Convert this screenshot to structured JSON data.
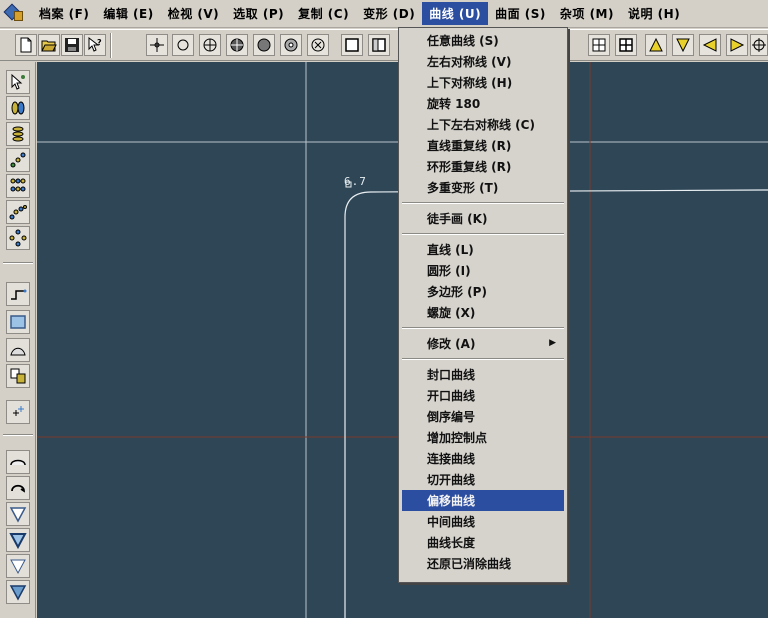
{
  "menubar": {
    "items": [
      {
        "label": "档案 (F)"
      },
      {
        "label": "编辑 (E)"
      },
      {
        "label": "检视 (V)"
      },
      {
        "label": "选取 (P)"
      },
      {
        "label": "复制 (C)"
      },
      {
        "label": "变形 (D)"
      },
      {
        "label": "曲线 (U)"
      },
      {
        "label": "曲面 (S)"
      },
      {
        "label": "杂项 (M)"
      },
      {
        "label": "说明 (H)"
      }
    ],
    "active_index": 6
  },
  "canvas": {
    "coord_label": "6.7"
  },
  "curve_menu": {
    "items": [
      {
        "label": "任意曲线 (S)",
        "type": "item"
      },
      {
        "label": "左右对称线 (V)",
        "type": "item"
      },
      {
        "label": "上下对称线 (H)",
        "type": "item"
      },
      {
        "label": "旋转 180",
        "type": "item"
      },
      {
        "label": "上下左右对称线 (C)",
        "type": "item"
      },
      {
        "label": "直线重复线 (R)",
        "type": "item"
      },
      {
        "label": "环形重复线 (R)",
        "type": "item"
      },
      {
        "label": "多重变形 (T)",
        "type": "item"
      },
      {
        "type": "separator"
      },
      {
        "label": "徒手画 (K)",
        "type": "item"
      },
      {
        "type": "separator"
      },
      {
        "label": "直线 (L)",
        "type": "item"
      },
      {
        "label": "圆形 (I)",
        "type": "item"
      },
      {
        "label": "多边形 (P)",
        "type": "item"
      },
      {
        "label": "螺旋 (X)",
        "type": "item"
      },
      {
        "type": "separator"
      },
      {
        "label": "修改 (A)",
        "type": "submenu"
      },
      {
        "type": "separator"
      },
      {
        "label": "封口曲线",
        "type": "item"
      },
      {
        "label": "开口曲线",
        "type": "item"
      },
      {
        "label": "倒序编号",
        "type": "item"
      },
      {
        "label": "增加控制点",
        "type": "item"
      },
      {
        "label": "连接曲线",
        "type": "item"
      },
      {
        "label": "切开曲线",
        "type": "item"
      },
      {
        "label": "偏移曲线",
        "type": "item",
        "highlighted": true
      },
      {
        "label": "中间曲线",
        "type": "item"
      },
      {
        "label": "曲线长度",
        "type": "item"
      },
      {
        "label": "还原已消除曲线",
        "type": "item"
      }
    ]
  },
  "colors": {
    "canvas_bg": "#2f4656",
    "menu_highlight": "#2c4ea0",
    "grid_white": "#c8d2d8",
    "grid_red": "#7a3a2a"
  }
}
